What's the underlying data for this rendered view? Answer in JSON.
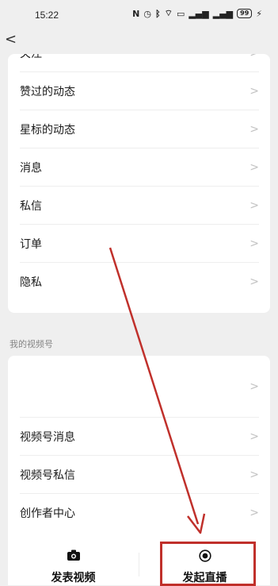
{
  "status_bar": {
    "time": "15:22",
    "icons": [
      "nfc-icon",
      "alarm-icon",
      "bluetooth-icon",
      "wifi-icon",
      "hd-icon",
      "signal-5g-icon",
      "signal-4g-icon"
    ],
    "battery": "99",
    "charging_glyph": "⚡"
  },
  "nav": {
    "back_glyph": "<"
  },
  "settings_list": {
    "items": [
      {
        "label": "关注"
      },
      {
        "label": "赞过的动态"
      },
      {
        "label": "星标的动态"
      },
      {
        "label": "消息"
      },
      {
        "label": "私信"
      },
      {
        "label": "订单"
      },
      {
        "label": "隐私"
      }
    ],
    "chevron": ">"
  },
  "channels_section": {
    "title": "我的视频号",
    "items": [
      {
        "label": ""
      },
      {
        "label": "视频号消息"
      },
      {
        "label": "视频号私信"
      },
      {
        "label": "创作者中心"
      }
    ]
  },
  "bottom_actions": {
    "publish_video": "发表视频",
    "start_live": "发起直播"
  },
  "annotation": {
    "color": "#c0302b"
  }
}
